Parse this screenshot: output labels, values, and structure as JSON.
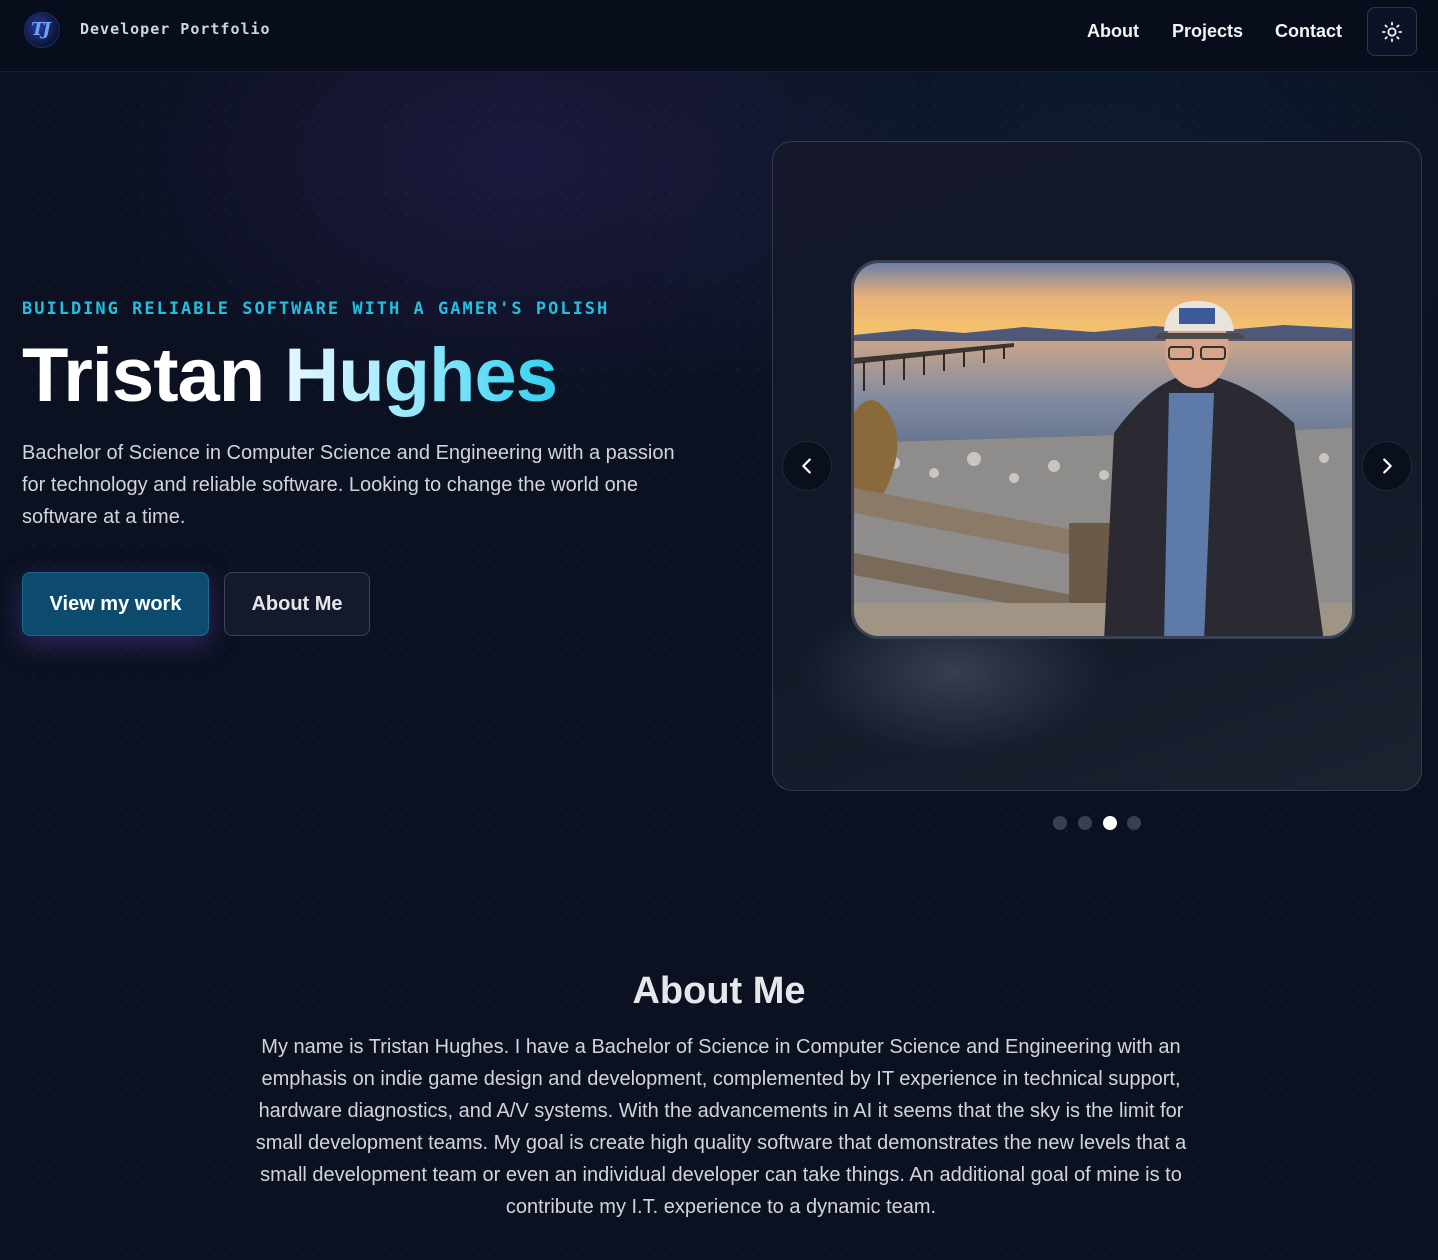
{
  "header": {
    "brand": "Developer Portfolio",
    "nav": [
      "About",
      "Projects",
      "Contact"
    ]
  },
  "hero": {
    "tagline": "BUILDING RELIABLE SOFTWARE WITH A GAMER'S POLISH",
    "first_name": "Tristan",
    "last_name": "Hughes",
    "intro": "Bachelor of Science in Computer Science and Engineering with a passion for technology and reliable software. Looking to change the world one software at a time.",
    "primary_button": "View my work",
    "secondary_button": "About Me"
  },
  "carousel": {
    "slide_count": 4,
    "active_index": 2
  },
  "about": {
    "title": "About Me",
    "text": "My name is Tristan Hughes. I have a Bachelor of Science in Computer Science and Engineering with an emphasis on indie game design and development, complemented by IT experience in technical support, hardware diagnostics, and A/V systems. With the advancements in AI it seems that the sky is the limit for small development teams. My goal is create high quality software that demonstrates the new levels that a small development team or even an individual developer can take things. An additional goal of mine is to contribute my I.T. experience to a dynamic team."
  },
  "colors": {
    "accent": "#22c0e0",
    "primary_button": "#0c4a6e",
    "background": "#0b1120"
  },
  "icons": [
    "logo",
    "sun-icon",
    "chevron-left-icon",
    "chevron-right-icon"
  ]
}
